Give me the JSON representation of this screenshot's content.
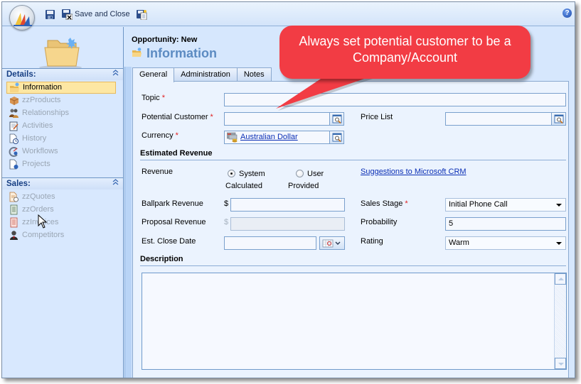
{
  "toolbar": {
    "save_icon": "save-icon",
    "save_close_label": "Save and Close",
    "save_close_icon": "save-and-close-icon",
    "save_new_icon": "save-and-new-icon",
    "help_icon": "help-icon",
    "help_glyph": "?"
  },
  "sidebar": {
    "details_header": "Details:",
    "details_items": [
      {
        "label": "Information",
        "icon": "information-folder-icon",
        "active": true
      },
      {
        "label": "zzProducts",
        "icon": "products-box-icon"
      },
      {
        "label": "Relationships",
        "icon": "relationships-people-icon"
      },
      {
        "label": "Activities",
        "icon": "activities-notepad-icon"
      },
      {
        "label": "History",
        "icon": "history-clock-icon"
      },
      {
        "label": "Workflows",
        "icon": "workflows-icon"
      },
      {
        "label": "Projects",
        "icon": "projects-icon"
      }
    ],
    "sales_header": "Sales:",
    "sales_items": [
      {
        "label": "zzQuotes",
        "icon": "quotes-icon"
      },
      {
        "label": "zzOrders",
        "icon": "orders-icon"
      },
      {
        "label": "zzInvoices",
        "icon": "invoices-icon"
      },
      {
        "label": "Competitors",
        "icon": "competitors-icon"
      }
    ],
    "collapse_glyph": "⌃"
  },
  "header": {
    "entity_type": "Opportunity: New",
    "title": "Information"
  },
  "tabs": [
    {
      "label": "General",
      "active": true
    },
    {
      "label": "Administration"
    },
    {
      "label": "Notes"
    }
  ],
  "form": {
    "topic": {
      "label": "Topic",
      "required": true,
      "value": ""
    },
    "potential_customer": {
      "label": "Potential Customer",
      "required": true,
      "value": ""
    },
    "price_list": {
      "label": "Price List",
      "value": ""
    },
    "currency": {
      "label": "Currency",
      "required": true,
      "value": "Australian Dollar"
    },
    "estimated_revenue_section": "Estimated Revenue",
    "revenue": {
      "label": "Revenue",
      "options": [
        {
          "line1": "System",
          "line2": "Calculated",
          "checked": true
        },
        {
          "line1": "User",
          "line2": "Provided",
          "checked": false
        }
      ]
    },
    "suggestions_link": "Suggestions to Microsoft CRM",
    "ballpark_revenue": {
      "label": "Ballpark Revenue",
      "currency_symbol": "$",
      "value": ""
    },
    "proposal_revenue": {
      "label": "Proposal Revenue",
      "currency_symbol": "$",
      "value": "",
      "disabled": true
    },
    "est_close_date": {
      "label": "Est. Close Date",
      "value": ""
    },
    "sales_stage": {
      "label": "Sales Stage",
      "required": true,
      "value": "Initial Phone Call"
    },
    "probability": {
      "label": "Probability",
      "value": "5"
    },
    "rating": {
      "label": "Rating",
      "value": "Warm"
    },
    "description_section": "Description",
    "description": {
      "value": ""
    },
    "required_marker": "*"
  },
  "callout": {
    "line1": "Always set potential customer to be a",
    "line2": "Company/Account",
    "color": "#f23c44"
  }
}
